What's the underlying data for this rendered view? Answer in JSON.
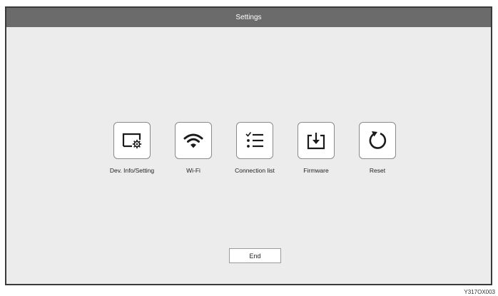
{
  "window": {
    "title": "Settings"
  },
  "menu": {
    "items": [
      {
        "label": "Dev. Info/Setting",
        "icon": "monitor-gear-icon"
      },
      {
        "label": "Wi-Fi",
        "icon": "wifi-icon"
      },
      {
        "label": "Connection list",
        "icon": "checklist-icon"
      },
      {
        "label": "Firmware",
        "icon": "download-tray-icon"
      },
      {
        "label": "Reset",
        "icon": "reset-arrow-icon"
      }
    ]
  },
  "footer": {
    "end_label": "End"
  },
  "figure_code": "Y317OX003"
}
